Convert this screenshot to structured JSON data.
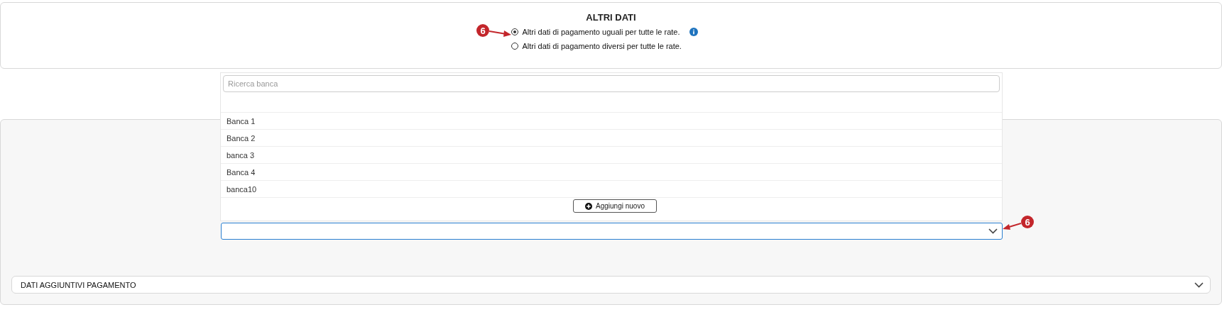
{
  "section": {
    "title": "ALTRI DATI",
    "options": [
      {
        "label": "Altri dati di pagamento uguali per tutte le rate.",
        "selected": true,
        "info": true
      },
      {
        "label": "Altri dati di pagamento diversi per tutte le rate.",
        "selected": false,
        "info": false
      }
    ]
  },
  "bank_select": {
    "expanded": true,
    "search": {
      "placeholder": "Ricerca banca"
    },
    "options": [
      {
        "label": "Banca 1"
      },
      {
        "label": "Banca 2"
      },
      {
        "label": "banca 3"
      },
      {
        "label": "Banca 4"
      },
      {
        "label": "banca10"
      }
    ],
    "add_button": "Aggiungi nuovo"
  },
  "accordion": {
    "title": "DATI AGGIUNTIVI PAGAMENTO",
    "expanded": false
  },
  "annotations": [
    {
      "label": "6"
    },
    {
      "label": "6"
    }
  ]
}
